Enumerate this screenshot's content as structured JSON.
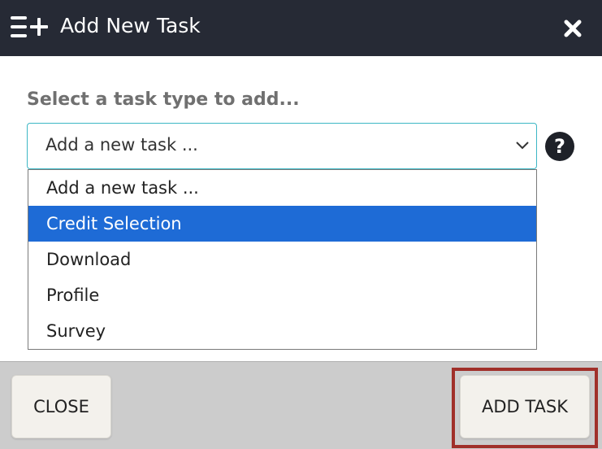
{
  "header": {
    "title": "Add New Task",
    "title_icon": "add-list-icon",
    "close_icon": "close-icon"
  },
  "body": {
    "prompt": "Select a task type to add...",
    "select": {
      "value": "Add a new task ...",
      "chevron_icon": "chevron-down-icon",
      "options": [
        "Add a new task ...",
        "Credit Selection",
        "Download",
        "Profile",
        "Survey"
      ],
      "highlighted_index": 1
    },
    "help_label": "?"
  },
  "footer": {
    "close_label": "CLOSE",
    "add_label": "ADD TASK"
  },
  "colors": {
    "header_bg": "#262a35",
    "select_border": "#3db7c5",
    "option_highlight": "#1e6bd6",
    "footer_bg": "#cccccc",
    "button_bg": "#f3f1ec",
    "add_button_outline": "#a0302a"
  }
}
